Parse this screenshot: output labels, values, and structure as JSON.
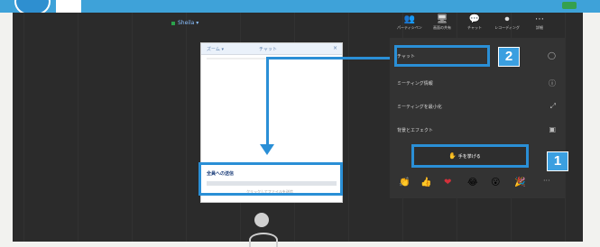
{
  "share_tag": "Sheila ▾",
  "toolbar": [
    {
      "icon": "participants-icon",
      "label": "パーティシペント",
      "glyph": "👥",
      "active": false
    },
    {
      "icon": "share-icon",
      "label": "画面の共有",
      "glyph": "🖥",
      "active": false
    },
    {
      "icon": "chat-icon",
      "label": "チャット",
      "glyph": "💬",
      "active": true
    },
    {
      "icon": "record-icon",
      "label": "レコーディング",
      "glyph": "⏺",
      "active": false
    },
    {
      "icon": "more-icon",
      "label": "詳細",
      "glyph": "⋯",
      "active": false
    }
  ],
  "chat_window": {
    "tab_left": "ズーム ▾",
    "title": "チャット",
    "close": "×",
    "input_text": "全員への送信",
    "hint": "クリックしてファイルを送信"
  },
  "menu": {
    "items": [
      {
        "label": "チャット",
        "icon": "chat-bubble-icon",
        "glyph": "◯"
      },
      {
        "label": "ミーティング情報",
        "icon": "info-icon",
        "glyph": "ⓘ"
      },
      {
        "label": "ミーティングを最小化",
        "icon": "minimize-icon",
        "glyph": "⤢"
      },
      {
        "label": "背景とエフェクト",
        "icon": "background-icon",
        "glyph": "▣"
      }
    ],
    "raise_hand_label": "手を挙げる"
  },
  "reactions": [
    {
      "name": "clap-icon",
      "glyph": "👏"
    },
    {
      "name": "thumbs-up-icon",
      "glyph": "👍"
    },
    {
      "name": "heart-icon",
      "glyph": "❤"
    },
    {
      "name": "laugh-icon",
      "glyph": "😂"
    },
    {
      "name": "surprised-icon",
      "glyph": "😮"
    },
    {
      "name": "party-icon",
      "glyph": "🎉"
    }
  ],
  "more_reactions": "···",
  "callouts": {
    "one": "1",
    "two": "2"
  },
  "colors": {
    "highlight": "#2a8fd6",
    "callout_fill": "#3b9fe0",
    "active": "#2ba24c"
  }
}
